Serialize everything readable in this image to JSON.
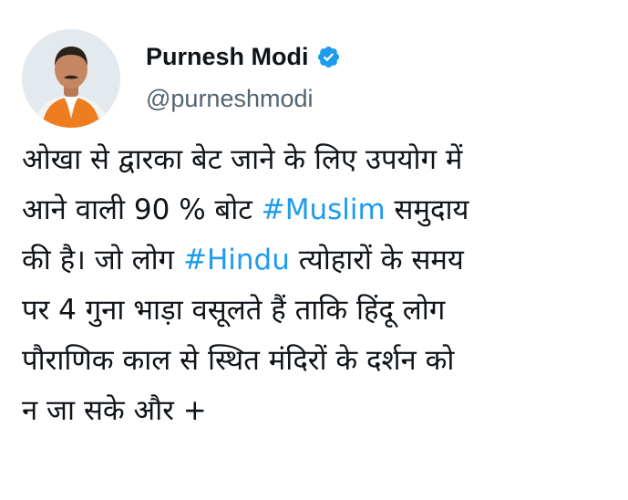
{
  "author": {
    "name": "Purnesh Modi",
    "handle": "@purneshmodi",
    "verified": true,
    "avatar_icon": "profile-photo-icon",
    "verified_icon": "verified-badge-icon",
    "verified_color": "#1d9bf0"
  },
  "tweet": {
    "lines": [
      {
        "segments": [
          {
            "text": "ओखा से द्वारका बेट जाने के लिए उपयोग में",
            "hashtag": false
          }
        ]
      },
      {
        "segments": [
          {
            "text": "आने वाली 90 % बोट ",
            "hashtag": false
          },
          {
            "text": "#Muslim",
            "hashtag": true
          },
          {
            "text": " समुदाय",
            "hashtag": false
          }
        ]
      },
      {
        "segments": [
          {
            "text": "की है। जो लोग ",
            "hashtag": false
          },
          {
            "text": "#Hindu",
            "hashtag": true
          },
          {
            "text": " त्योहारों के समय",
            "hashtag": false
          }
        ]
      },
      {
        "segments": [
          {
            "text": "पर 4 गुना भाड़ा वसूलते हैं ताकि हिंदू लोग",
            "hashtag": false
          }
        ]
      },
      {
        "segments": [
          {
            "text": "पौराणिक काल से स्थित मंदिरों के दर्शन को",
            "hashtag": false
          }
        ]
      },
      {
        "segments": [
          {
            "text": "न जा सके और +",
            "hashtag": false
          }
        ]
      }
    ],
    "hashtag_color": "#1d9bf0",
    "text_color": "#0f1419"
  }
}
